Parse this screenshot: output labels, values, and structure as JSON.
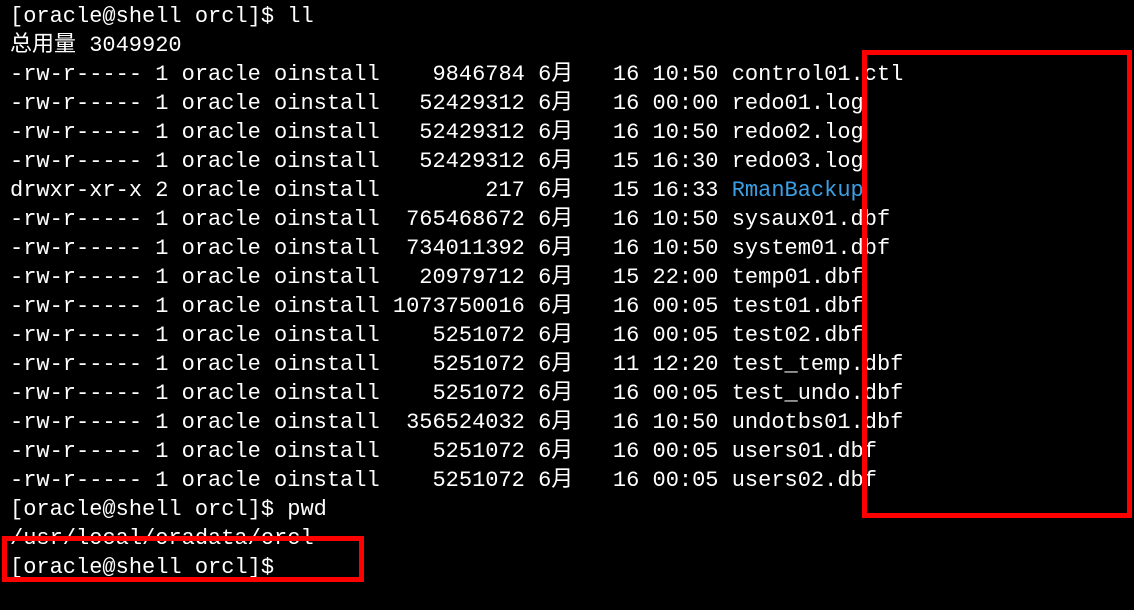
{
  "prompt1": "[oracle@shell orcl]$ ll",
  "total_line": "总用量 3049920",
  "files": [
    {
      "perm": "-rw-r-----",
      "links": "1",
      "owner": "oracle",
      "group": "oinstall",
      "size": "9846784",
      "month": "6月",
      "day": "16",
      "time": "10:50",
      "name": "control01.ctl",
      "type": "file"
    },
    {
      "perm": "-rw-r-----",
      "links": "1",
      "owner": "oracle",
      "group": "oinstall",
      "size": "52429312",
      "month": "6月",
      "day": "16",
      "time": "00:00",
      "name": "redo01.log",
      "type": "file"
    },
    {
      "perm": "-rw-r-----",
      "links": "1",
      "owner": "oracle",
      "group": "oinstall",
      "size": "52429312",
      "month": "6月",
      "day": "16",
      "time": "10:50",
      "name": "redo02.log",
      "type": "file"
    },
    {
      "perm": "-rw-r-----",
      "links": "1",
      "owner": "oracle",
      "group": "oinstall",
      "size": "52429312",
      "month": "6月",
      "day": "15",
      "time": "16:30",
      "name": "redo03.log",
      "type": "file"
    },
    {
      "perm": "drwxr-xr-x",
      "links": "2",
      "owner": "oracle",
      "group": "oinstall",
      "size": "217",
      "month": "6月",
      "day": "15",
      "time": "16:33",
      "name": "RmanBackup",
      "type": "dir"
    },
    {
      "perm": "-rw-r-----",
      "links": "1",
      "owner": "oracle",
      "group": "oinstall",
      "size": "765468672",
      "month": "6月",
      "day": "16",
      "time": "10:50",
      "name": "sysaux01.dbf",
      "type": "file"
    },
    {
      "perm": "-rw-r-----",
      "links": "1",
      "owner": "oracle",
      "group": "oinstall",
      "size": "734011392",
      "month": "6月",
      "day": "16",
      "time": "10:50",
      "name": "system01.dbf",
      "type": "file"
    },
    {
      "perm": "-rw-r-----",
      "links": "1",
      "owner": "oracle",
      "group": "oinstall",
      "size": "20979712",
      "month": "6月",
      "day": "15",
      "time": "22:00",
      "name": "temp01.dbf",
      "type": "file"
    },
    {
      "perm": "-rw-r-----",
      "links": "1",
      "owner": "oracle",
      "group": "oinstall",
      "size": "1073750016",
      "month": "6月",
      "day": "16",
      "time": "00:05",
      "name": "test01.dbf",
      "type": "file"
    },
    {
      "perm": "-rw-r-----",
      "links": "1",
      "owner": "oracle",
      "group": "oinstall",
      "size": "5251072",
      "month": "6月",
      "day": "16",
      "time": "00:05",
      "name": "test02.dbf",
      "type": "file"
    },
    {
      "perm": "-rw-r-----",
      "links": "1",
      "owner": "oracle",
      "group": "oinstall",
      "size": "5251072",
      "month": "6月",
      "day": "11",
      "time": "12:20",
      "name": "test_temp.dbf",
      "type": "file"
    },
    {
      "perm": "-rw-r-----",
      "links": "1",
      "owner": "oracle",
      "group": "oinstall",
      "size": "5251072",
      "month": "6月",
      "day": "16",
      "time": "00:05",
      "name": "test_undo.dbf",
      "type": "file"
    },
    {
      "perm": "-rw-r-----",
      "links": "1",
      "owner": "oracle",
      "group": "oinstall",
      "size": "356524032",
      "month": "6月",
      "day": "16",
      "time": "10:50",
      "name": "undotbs01.dbf",
      "type": "file"
    },
    {
      "perm": "-rw-r-----",
      "links": "1",
      "owner": "oracle",
      "group": "oinstall",
      "size": "5251072",
      "month": "6月",
      "day": "16",
      "time": "00:05",
      "name": "users01.dbf",
      "type": "file"
    },
    {
      "perm": "-rw-r-----",
      "links": "1",
      "owner": "oracle",
      "group": "oinstall",
      "size": "5251072",
      "month": "6月",
      "day": "16",
      "time": "00:05",
      "name": "users02.dbf",
      "type": "file"
    }
  ],
  "prompt2": "[oracle@shell orcl]$ pwd",
  "pwd_output": "/usr/local/oradata/orcl",
  "prompt3": "[oracle@shell orcl]$ "
}
